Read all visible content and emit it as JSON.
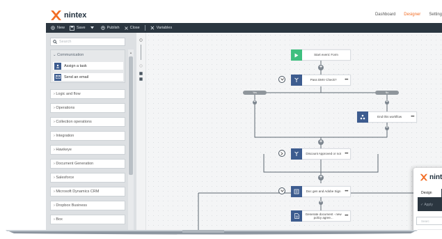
{
  "brand": {
    "name": "nintex",
    "accent": "#f26c23",
    "dark": "#2b3640"
  },
  "topnav": [
    {
      "label": "Dashboard",
      "active": false
    },
    {
      "label": "Designer",
      "active": true
    },
    {
      "label": "Setting",
      "active": false
    }
  ],
  "toolbar": {
    "new": "New",
    "save": "Save",
    "publish": "Publish",
    "close": "Close",
    "variables": "Variables"
  },
  "sidebar": {
    "search_placeholder": "Search",
    "communication": {
      "title": "Communication",
      "items": [
        "Assign a task",
        "Send an email"
      ]
    },
    "categories": [
      "Logic and flow",
      "Operations",
      "Collection operations",
      "Integration",
      "Hawkeye",
      "Document Generation",
      "Salesforce",
      "Microsoft Dynamics CRM",
      "Dropbox Business",
      "Box"
    ]
  },
  "workflow": {
    "start": "Start event: Form",
    "branch": "Pass DMV Check?",
    "yes": "Yes",
    "no": "No",
    "end": "End this workflow",
    "discount": "Discount Approved or not",
    "docgen": "Doc gen and Adobe Sign",
    "generate": "Generate document - new policy agree..."
  },
  "overlay": {
    "logo": "nint",
    "tab": "Design",
    "apply": "Apply",
    "search": "Searc"
  }
}
